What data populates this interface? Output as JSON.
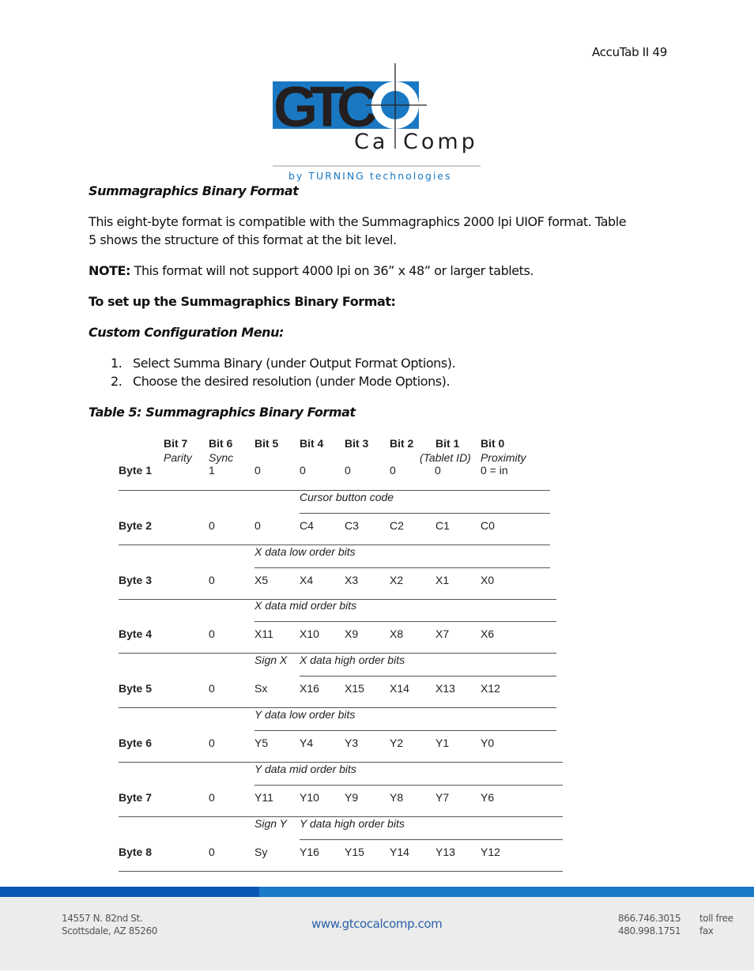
{
  "header": {
    "page_label": "AccuTab II 49"
  },
  "logo": {
    "mark": "GTCO",
    "name_left": "Ca",
    "name_right": "Comp",
    "tagline": "by TURNING technologies",
    "colors": {
      "blue": "#1a78c2",
      "dark": "#231f20"
    }
  },
  "section": {
    "title": "Summagraphics Binary Format",
    "para_line1": "This eight-byte format is compatible with the Summagraphics 2000 lpi UIOF format.  Table",
    "para_line2": "5 shows the structure of this format at the bit level.",
    "note_label": "NOTE:",
    "note_text": " This format will not support 4000 lpi on 36” x 48” or larger tablets.",
    "setup_heading": "To set up the Summagraphics Binary Format:",
    "menu_heading": "Custom Configuration Menu:",
    "steps": [
      {
        "num": "1.",
        "text": "Select Summa Binary (under Output Format Options)."
      },
      {
        "num": "2.",
        "text": "Choose the desired resolution (under Mode Options)."
      }
    ],
    "table_caption": "Table 5: Summagraphics Binary Format"
  },
  "table": {
    "bit_headers": [
      "Bit 7",
      "Bit 6",
      "Bit 5",
      "Bit 4",
      "Bit 3",
      "Bit 2",
      "Bit 1",
      "Bit 0"
    ],
    "bit_sublabels": {
      "bit7": "Parity",
      "bit6": "Sync",
      "bit1": "(Tablet ID)",
      "bit0": "Proximity"
    },
    "rows": [
      {
        "label": "Byte 1",
        "group": "",
        "group2": "",
        "cells": [
          "",
          "1",
          "0",
          "0",
          "0",
          "0",
          "0",
          "0 = in"
        ]
      },
      {
        "label": "Byte 2",
        "group": "Cursor button code",
        "group2": "",
        "cells": [
          "",
          "0",
          "0",
          "C4",
          "C3",
          "C2",
          "C1",
          "C0"
        ]
      },
      {
        "label": "Byte 3",
        "group": "X data low order bits",
        "group2": "",
        "cells": [
          "",
          "0",
          "X5",
          "X4",
          "X3",
          "X2",
          "X1",
          "X0"
        ]
      },
      {
        "label": "Byte 4",
        "group": "X data mid order bits",
        "group2": "",
        "cells": [
          "",
          "0",
          "X11",
          "X10",
          "X9",
          "X8",
          "X7",
          "X6"
        ]
      },
      {
        "label": "Byte 5",
        "group": "Sign X",
        "group2": "X data high order bits",
        "cells": [
          "",
          "0",
          "Sx",
          "X16",
          "X15",
          "X14",
          "X13",
          "X12"
        ]
      },
      {
        "label": "Byte 6",
        "group": "Y data low order bits",
        "group2": "",
        "cells": [
          "",
          "0",
          "Y5",
          "Y4",
          "Y3",
          "Y2",
          "Y1",
          "Y0"
        ]
      },
      {
        "label": "Byte 7",
        "group": "Y data mid order bits",
        "group2": "",
        "cells": [
          "",
          "0",
          "Y11",
          "Y10",
          "Y9",
          "Y8",
          "Y7",
          "Y6"
        ]
      },
      {
        "label": "Byte 8",
        "group": "Sign Y",
        "group2": "Y data high order bits",
        "cells": [
          "",
          "0",
          "Sy",
          "Y16",
          "Y15",
          "Y14",
          "Y13",
          "Y12"
        ]
      }
    ]
  },
  "footer": {
    "address_line1": "14557 N. 82nd St.",
    "address_line2": "Scottsdale, AZ 85260",
    "website": "www.gtcocalcomp.com",
    "phone1": "866.746.3015",
    "phone1_label": "toll free",
    "phone2": "480.998.1751",
    "phone2_label": "fax"
  }
}
